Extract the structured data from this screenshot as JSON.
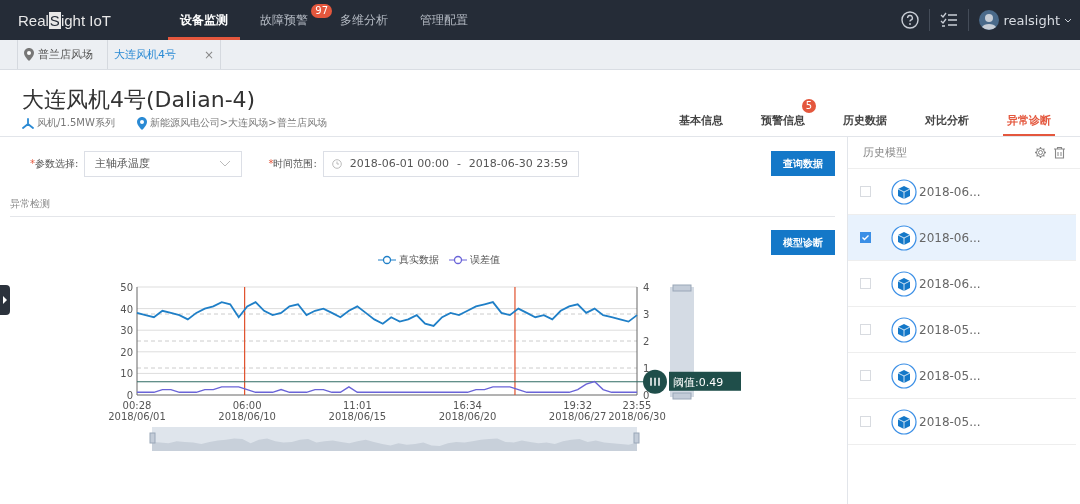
{
  "topbar": {
    "logo": {
      "before": "Real",
      "boxed": "S",
      "after": "ight IoT"
    },
    "nav": [
      {
        "label": "设备监测",
        "selected": true
      },
      {
        "label": "故障预警",
        "selected": false,
        "badge": "97"
      },
      {
        "label": "多维分析",
        "selected": false
      },
      {
        "label": "管理配置",
        "selected": false
      }
    ],
    "user": "realsight"
  },
  "breadcrumb_tabs": [
    {
      "label": "普兰店风场",
      "kind": "location",
      "selected": false
    },
    {
      "label": "大连风机4号",
      "kind": "closable",
      "selected": true,
      "close": "×"
    }
  ],
  "header": {
    "title": "大连风机4号(Dalian-4)",
    "model": "风机/1.5MW系列",
    "location": "新能源风电公司>大连风场>普兰店风场",
    "tabs": [
      {
        "label": "基本信息",
        "selected": false
      },
      {
        "label": "预警信息",
        "selected": false,
        "badge": "5"
      },
      {
        "label": "历史数据",
        "selected": false
      },
      {
        "label": "对比分析",
        "selected": false
      },
      {
        "label": "异常诊断",
        "selected": true
      }
    ]
  },
  "query": {
    "required_mark": "*",
    "param_label": "参数选择:",
    "param_value": "主轴承温度",
    "time_label": "时间范围:",
    "time_start": "2018-06-01 00:00",
    "time_sep": "-",
    "time_end": "2018-06-30 23:59",
    "button": "查询数据"
  },
  "section": {
    "title": "异常检测",
    "button": "模型诊断",
    "chart_data": {
      "type": "line",
      "categories": [
        "00:28\n2018/06/01",
        null,
        null,
        null,
        null,
        null,
        null,
        null,
        null,
        null,
        null,
        null,
        null,
        "06:00\n2018/06/10",
        null,
        null,
        null,
        null,
        null,
        null,
        null,
        null,
        null,
        null,
        null,
        null,
        "11:01\n2018/06/15",
        null,
        null,
        null,
        null,
        null,
        null,
        null,
        null,
        null,
        null,
        null,
        null,
        "16:34\n2018/06/20",
        null,
        null,
        null,
        null,
        null,
        null,
        null,
        null,
        null,
        null,
        null,
        null,
        "19:32\n2018/06/27",
        null,
        null,
        null,
        null,
        null,
        null,
        "23:55\n2018/06/30"
      ],
      "ylim": [
        0,
        50
      ],
      "yticks": [
        0,
        10,
        20,
        30,
        40,
        50
      ],
      "grid": true,
      "y2lim": [
        0,
        4
      ],
      "y2ticks": [
        0,
        1,
        2,
        3,
        4
      ],
      "series": [
        {
          "name": "真实数据",
          "color": "#1f7fc7",
          "values": [
            38,
            37,
            36,
            39,
            38,
            37,
            35,
            38,
            40,
            41,
            43,
            42,
            36,
            41,
            43,
            39,
            37,
            38,
            41,
            42,
            37,
            39,
            40,
            38,
            36,
            39,
            41,
            38,
            35,
            33,
            36,
            34,
            35,
            37,
            33,
            32,
            36,
            38,
            37,
            39,
            41,
            42,
            43,
            38,
            37,
            40,
            38,
            36,
            37,
            35,
            39,
            41,
            42,
            38,
            40,
            37,
            36,
            35,
            34,
            37
          ]
        },
        {
          "name": "误差值",
          "color": "#6a64d8",
          "axis": "y2",
          "values": [
            0.1,
            0.1,
            0.1,
            0.2,
            0.2,
            0.1,
            0.1,
            0.1,
            0.2,
            0.2,
            0.3,
            0.3,
            0.3,
            0.2,
            0.1,
            0.1,
            0.1,
            0.2,
            0.1,
            0.1,
            0.1,
            0.2,
            0.2,
            0.1,
            0.1,
            0.3,
            0.1,
            0.1,
            0.1,
            0.1,
            0.1,
            0.1,
            0.1,
            0.1,
            0.1,
            0.1,
            0.1,
            0.1,
            0.1,
            0.1,
            0.2,
            0.2,
            0.3,
            0.3,
            0.3,
            0.2,
            0.1,
            0.1,
            0.1,
            0.1,
            0.1,
            0.1,
            0.2,
            0.4,
            0.5,
            0.2,
            0.1,
            0.1,
            0.1,
            0.1
          ]
        }
      ],
      "ref_lines": [
        {
          "axis": "y2",
          "value": 0.49,
          "label": "阈值:0.49"
        }
      ]
    }
  },
  "history": {
    "title": "历史模型",
    "items": [
      {
        "label": "2018-06...",
        "checked": false,
        "selected": false
      },
      {
        "label": "2018-06...",
        "checked": true,
        "selected": true
      },
      {
        "label": "2018-06...",
        "checked": false,
        "selected": false
      },
      {
        "label": "2018-05...",
        "checked": false,
        "selected": false
      },
      {
        "label": "2018-05...",
        "checked": false,
        "selected": false
      },
      {
        "label": "2018-05...",
        "checked": false,
        "selected": false
      }
    ]
  }
}
